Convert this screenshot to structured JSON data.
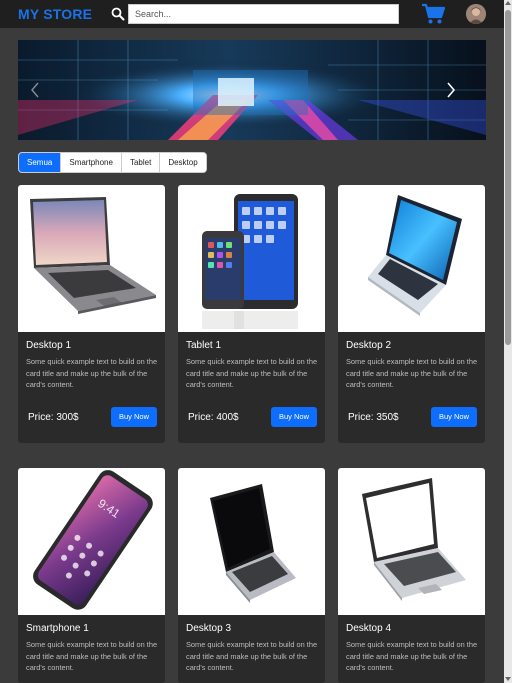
{
  "navbar": {
    "brand": "MY STORE",
    "search_placeholder": "Search...",
    "search_icon": "search-icon",
    "cart_icon": "cart-icon",
    "avatar_icon": "avatar"
  },
  "carousel": {
    "prev_icon": "chevron-left-icon",
    "next_icon": "chevron-right-icon"
  },
  "filters": [
    "Semua",
    "Smartphone",
    "Tablet",
    "Desktop"
  ],
  "active_filter": "Semua",
  "products": [
    {
      "title": "Desktop 1",
      "text": "Some quick example text to build on the card title and make up the bulk of the card's content.",
      "price": "Price: 300$",
      "button": "Buy Now"
    },
    {
      "title": "Tablet 1",
      "text": "Some quick example text to build on the card title and make up the bulk of the card's content.",
      "price": "Price: 400$",
      "button": "Buy Now"
    },
    {
      "title": "Desktop 2",
      "text": "Some quick example text to build on the card title and make up the bulk of the card's content.",
      "price": "Price: 350$",
      "button": "Buy Now"
    },
    {
      "title": "Smartphone 1",
      "text": "Some quick example text to build on the card title and make up the bulk of the card's content.",
      "price": "",
      "button": ""
    },
    {
      "title": "Desktop 3",
      "text": "Some quick example text to build on the card title and make up the bulk of the card's content.",
      "price": "",
      "button": ""
    },
    {
      "title": "Desktop 4",
      "text": "Some quick example text to build on the card title and make up the bulk of the card's content.",
      "price": "",
      "button": ""
    }
  ],
  "colors": {
    "accent": "#0d6efd",
    "brand": "#1a73e8",
    "background": "#3b3b3b",
    "card": "#2a2a2a"
  }
}
